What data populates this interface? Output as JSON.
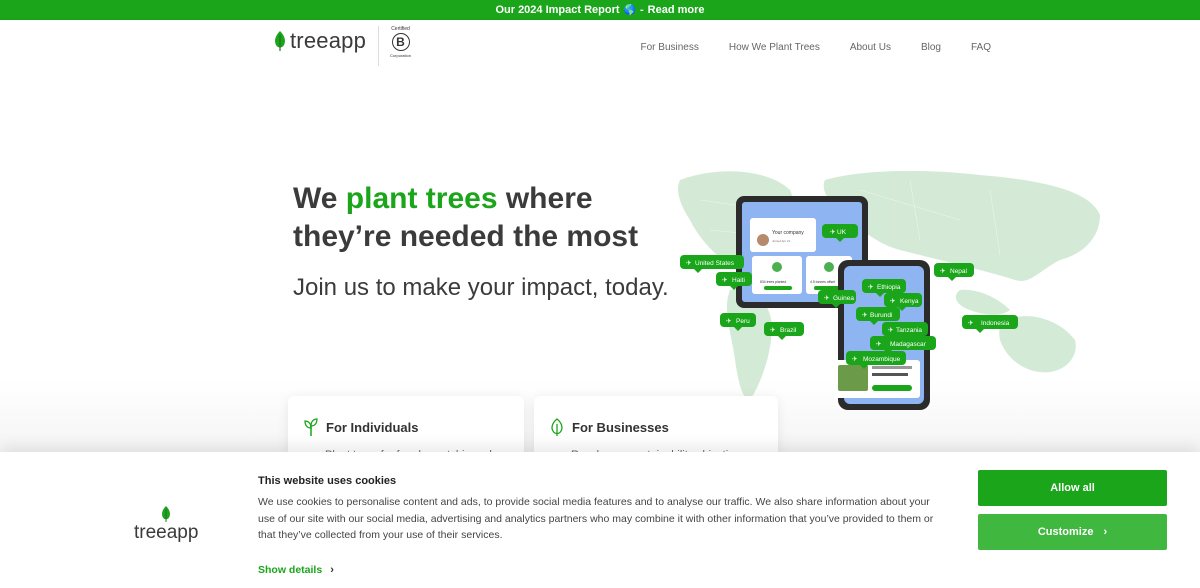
{
  "banner": {
    "text": "Our 2024 Impact Report",
    "globe_icon": "globe-icon",
    "separator": "-",
    "link": "Read more"
  },
  "header": {
    "logo_text": "treeapp",
    "bcorp": {
      "certified": "Certified",
      "letter": "B",
      "corporation": "Corporation"
    },
    "nav": [
      "For Business",
      "How We Plant Trees",
      "About Us",
      "Blog",
      "FAQ"
    ]
  },
  "hero": {
    "headline_pre": "We ",
    "headline_green": "plant trees",
    "headline_post": " where they’re needed the most",
    "subline": "Join us to make your impact, today."
  },
  "map": {
    "pins": [
      "UK",
      "United States",
      "Haiti",
      "Guinea",
      "Ethiopia",
      "Kenya",
      "Nepal",
      "Peru",
      "Brazil",
      "Burundi",
      "Tanzania",
      "Indonesia",
      "Madagascar",
      "Mozambique"
    ],
    "tablet": {
      "company": "Your company",
      "joined": "Joined Apr 21",
      "trees": "834 trees planted",
      "offset": "4.5 tonnes offset"
    }
  },
  "cards": [
    {
      "title": "For Individuals",
      "desc": "Plant trees for free by watching ads"
    },
    {
      "title": "For Businesses",
      "desc": "Reach your sustainability objectives"
    }
  ],
  "cookie": {
    "logo_text": "treeapp",
    "title": "This website uses cookies",
    "text": "We use cookies to personalise content and ads, to provide social media features and to analyse our traffic. We also share information about your use of our site with our social media, advertising and analytics partners who may combine it with other information that you’ve provided to them or that they’ve collected from your use of their services.",
    "show_details": "Show details",
    "allow_all": "Allow all",
    "customize": "Customize"
  },
  "colors": {
    "brand_green": "#1aa51a",
    "text_dark": "#3b3b3b"
  }
}
